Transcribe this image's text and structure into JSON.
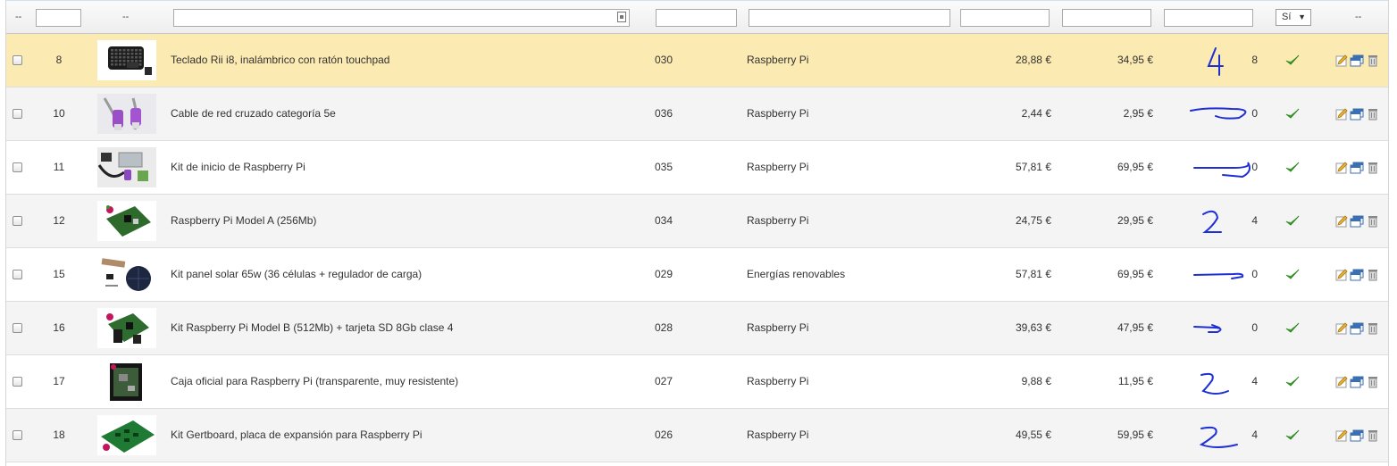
{
  "filters": {
    "dash_left": "--",
    "dash_image": "--",
    "dash_right": "--",
    "active_value": "Sí"
  },
  "colors": {
    "highlight_row": "#fbeab1",
    "ink_annotation": "#1f2fd6",
    "active_check": "#3aa12a"
  },
  "rows": [
    {
      "id": "8",
      "name": "Teclado Rii i8, inalámbrico con ratón touchpad",
      "reference": "030",
      "category": "Raspberry Pi",
      "price_excl": "28,88 €",
      "price_incl": "34,95 €",
      "stock": "8",
      "active": "check-icon",
      "thumb": "keyboard-thumbnail"
    },
    {
      "id": "10",
      "name": "Cable de red cruzado categoría 5e",
      "reference": "036",
      "category": "Raspberry Pi",
      "price_excl": "2,44 €",
      "price_incl": "2,95 €",
      "stock": "0",
      "active": "check-icon",
      "thumb": "cable-thumbnail"
    },
    {
      "id": "11",
      "name": "Kit de inicio de Raspberry Pi",
      "reference": "035",
      "category": "Raspberry Pi",
      "price_excl": "57,81 €",
      "price_incl": "69,95 €",
      "stock": "0",
      "active": "check-icon",
      "thumb": "kit-thumbnail"
    },
    {
      "id": "12",
      "name": "Raspberry Pi Model A (256Mb)",
      "reference": "034",
      "category": "Raspberry Pi",
      "price_excl": "24,75 €",
      "price_incl": "29,95 €",
      "stock": "4",
      "active": "check-icon",
      "thumb": "board-thumbnail"
    },
    {
      "id": "15",
      "name": "Kit panel solar 65w (36 células + regulador de carga)",
      "reference": "029",
      "category": "Energías renovables",
      "price_excl": "57,81 €",
      "price_incl": "69,95 €",
      "stock": "0",
      "active": "check-icon",
      "thumb": "solar-thumbnail"
    },
    {
      "id": "16",
      "name": "Kit Raspberry Pi Model B (512Mb) + tarjeta SD 8Gb clase 4",
      "reference": "028",
      "category": "Raspberry Pi",
      "price_excl": "39,63 €",
      "price_incl": "47,95 €",
      "stock": "0",
      "active": "check-icon",
      "thumb": "board-sd-thumbnail"
    },
    {
      "id": "17",
      "name": "Caja oficial para Raspberry Pi (transparente, muy resistente)",
      "reference": "027",
      "category": "Raspberry Pi",
      "price_excl": "9,88 €",
      "price_incl": "11,95 €",
      "stock": "4",
      "active": "check-icon",
      "thumb": "case-thumbnail"
    },
    {
      "id": "18",
      "name": "Kit Gertboard, placa de expansión para Raspberry Pi",
      "reference": "026",
      "category": "Raspberry Pi",
      "price_excl": "49,55 €",
      "price_incl": "59,95 €",
      "stock": "4",
      "active": "check-icon",
      "thumb": "gertboard-thumbnail"
    }
  ]
}
